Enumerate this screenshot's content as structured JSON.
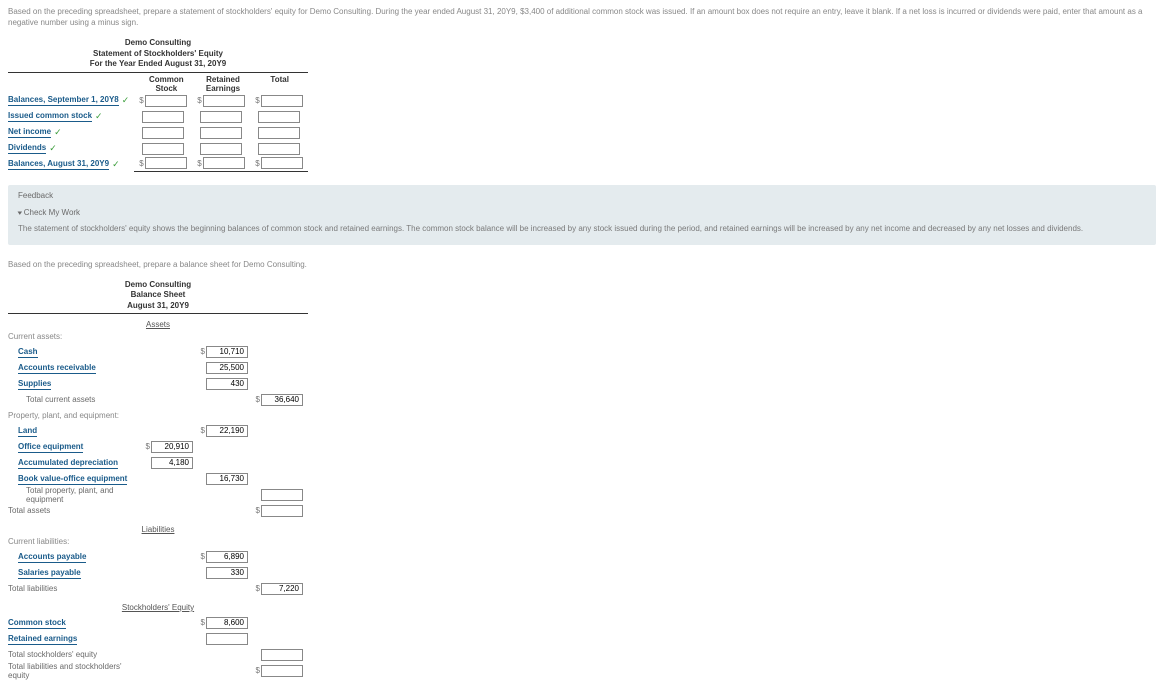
{
  "instruction1": "Based on the preceding spreadsheet, prepare a statement of stockholders' equity for Demo Consulting. During the year ended August 31, 20Y9, $3,400 of additional common stock was issued. If an amount box does not require an entry, leave it blank. If a net loss is incurred or dividends were paid, enter that amount as a negative number using a minus sign.",
  "stmt": {
    "company": "Demo Consulting",
    "title": "Statement of Stockholders' Equity",
    "period": "For the Year Ended August 31, 20Y9",
    "col1": "Common Stock",
    "col2": "Retained Earnings",
    "col3": "Total",
    "rows": {
      "r1": "Balances, September 1, 20Y8",
      "r2": "Issued common stock",
      "r3": "Net income",
      "r4": "Dividends",
      "r5": "Balances, August 31, 20Y9"
    }
  },
  "feedback": {
    "header": "Feedback",
    "check": "Check My Work",
    "text": "The statement of stockholders' equity shows the beginning balances of common stock and retained earnings. The common stock balance will be increased by any stock issued during the period, and retained earnings will be increased by any net income and decreased by any net losses and dividends."
  },
  "instruction2": "Based on the preceding spreadsheet, prepare a balance sheet for Demo Consulting.",
  "bs": {
    "company": "Demo Consulting",
    "title": "Balance Sheet",
    "date": "August 31, 20Y9",
    "sec_assets": "Assets",
    "cur_assets": "Current assets:",
    "cash": "Cash",
    "cash_v": "10,710",
    "ar": "Accounts receivable",
    "ar_v": "25,500",
    "supplies": "Supplies",
    "supplies_v": "430",
    "tca": "Total current assets",
    "tca_v": "36,640",
    "ppe": "Property, plant, and equipment:",
    "land": "Land",
    "land_v": "22,190",
    "oe": "Office equipment",
    "oe_v": "20,910",
    "ad": "Accumulated depreciation",
    "ad_v": "4,180",
    "bvoe": "Book value-office equipment",
    "bvoe_v": "16,730",
    "tppe": "Total property, plant, and equipment",
    "ta": "Total assets",
    "sec_liab": "Liabilities",
    "cur_liab": "Current liabilities:",
    "ap": "Accounts payable",
    "ap_v": "6,890",
    "sp": "Salaries payable",
    "sp_v": "330",
    "tl": "Total liabilities",
    "tl_v": "7,220",
    "sec_se": "Stockholders' Equity",
    "cs": "Common stock",
    "cs_v": "8,600",
    "re": "Retained earnings",
    "tse": "Total stockholders' equity",
    "tlse": "Total liabilities and stockholders' equity"
  }
}
